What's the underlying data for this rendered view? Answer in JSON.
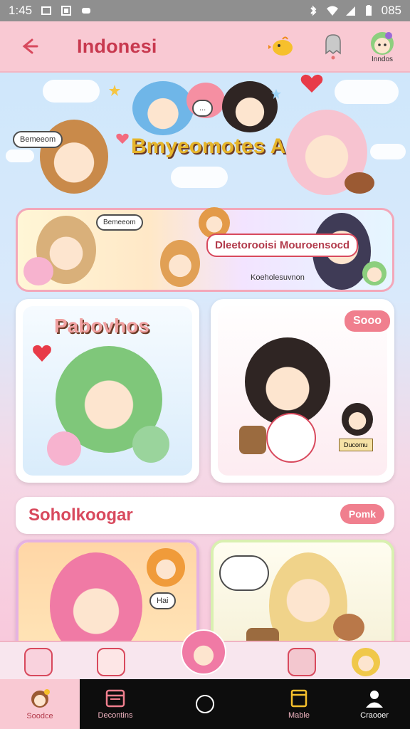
{
  "status_bar": {
    "time": "1:45",
    "battery": "085"
  },
  "app_bar": {
    "title": "Indonesi",
    "profile_label": "Inndos"
  },
  "hero": {
    "title": "Bmyeomotes A",
    "bubbles": [
      "Bemeeom",
      "..."
    ]
  },
  "banner": {
    "bubble_text": "Dleetorooisi Mouroensocd",
    "label": "Koeholesuvnon"
  },
  "cards": [
    {
      "title": "Pabovhos"
    },
    {
      "badge": "Sooo",
      "sign": "Ducomu"
    }
  ],
  "section": {
    "title": "Soholkoogar",
    "pill": "Pomk"
  },
  "nav": {
    "items": [
      {
        "label": "Soodce"
      },
      {
        "label": "Decontins"
      },
      {
        "label": "Mable"
      },
      {
        "label": "Craooer"
      }
    ]
  },
  "colors": {
    "accent": "#d8495d",
    "appbar": "#f9c9d3",
    "pill": "#f07f8e",
    "nav_bg": "#0d0d0d"
  }
}
